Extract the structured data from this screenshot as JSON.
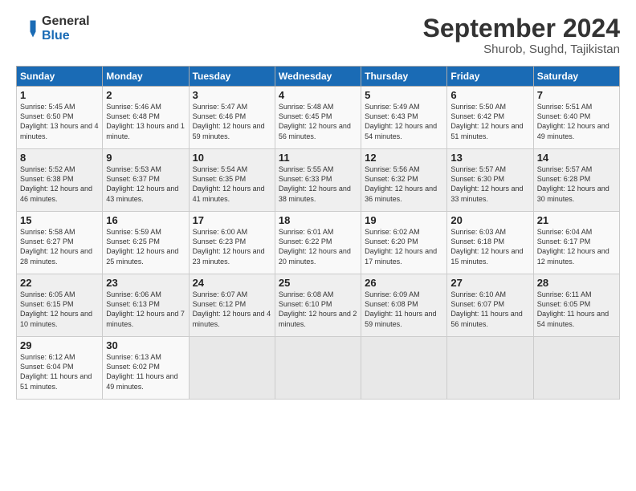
{
  "header": {
    "logo_general": "General",
    "logo_blue": "Blue",
    "month_title": "September 2024",
    "location": "Shurob, Sughd, Tajikistan"
  },
  "weekdays": [
    "Sunday",
    "Monday",
    "Tuesday",
    "Wednesday",
    "Thursday",
    "Friday",
    "Saturday"
  ],
  "weeks": [
    [
      {
        "day": "1",
        "sunrise": "5:45 AM",
        "sunset": "6:50 PM",
        "daylight": "13 hours and 4 minutes."
      },
      {
        "day": "2",
        "sunrise": "5:46 AM",
        "sunset": "6:48 PM",
        "daylight": "13 hours and 1 minute."
      },
      {
        "day": "3",
        "sunrise": "5:47 AM",
        "sunset": "6:46 PM",
        "daylight": "12 hours and 59 minutes."
      },
      {
        "day": "4",
        "sunrise": "5:48 AM",
        "sunset": "6:45 PM",
        "daylight": "12 hours and 56 minutes."
      },
      {
        "day": "5",
        "sunrise": "5:49 AM",
        "sunset": "6:43 PM",
        "daylight": "12 hours and 54 minutes."
      },
      {
        "day": "6",
        "sunrise": "5:50 AM",
        "sunset": "6:42 PM",
        "daylight": "12 hours and 51 minutes."
      },
      {
        "day": "7",
        "sunrise": "5:51 AM",
        "sunset": "6:40 PM",
        "daylight": "12 hours and 49 minutes."
      }
    ],
    [
      {
        "day": "8",
        "sunrise": "5:52 AM",
        "sunset": "6:38 PM",
        "daylight": "12 hours and 46 minutes."
      },
      {
        "day": "9",
        "sunrise": "5:53 AM",
        "sunset": "6:37 PM",
        "daylight": "12 hours and 43 minutes."
      },
      {
        "day": "10",
        "sunrise": "5:54 AM",
        "sunset": "6:35 PM",
        "daylight": "12 hours and 41 minutes."
      },
      {
        "day": "11",
        "sunrise": "5:55 AM",
        "sunset": "6:33 PM",
        "daylight": "12 hours and 38 minutes."
      },
      {
        "day": "12",
        "sunrise": "5:56 AM",
        "sunset": "6:32 PM",
        "daylight": "12 hours and 36 minutes."
      },
      {
        "day": "13",
        "sunrise": "5:57 AM",
        "sunset": "6:30 PM",
        "daylight": "12 hours and 33 minutes."
      },
      {
        "day": "14",
        "sunrise": "5:57 AM",
        "sunset": "6:28 PM",
        "daylight": "12 hours and 30 minutes."
      }
    ],
    [
      {
        "day": "15",
        "sunrise": "5:58 AM",
        "sunset": "6:27 PM",
        "daylight": "12 hours and 28 minutes."
      },
      {
        "day": "16",
        "sunrise": "5:59 AM",
        "sunset": "6:25 PM",
        "daylight": "12 hours and 25 minutes."
      },
      {
        "day": "17",
        "sunrise": "6:00 AM",
        "sunset": "6:23 PM",
        "daylight": "12 hours and 23 minutes."
      },
      {
        "day": "18",
        "sunrise": "6:01 AM",
        "sunset": "6:22 PM",
        "daylight": "12 hours and 20 minutes."
      },
      {
        "day": "19",
        "sunrise": "6:02 AM",
        "sunset": "6:20 PM",
        "daylight": "12 hours and 17 minutes."
      },
      {
        "day": "20",
        "sunrise": "6:03 AM",
        "sunset": "6:18 PM",
        "daylight": "12 hours and 15 minutes."
      },
      {
        "day": "21",
        "sunrise": "6:04 AM",
        "sunset": "6:17 PM",
        "daylight": "12 hours and 12 minutes."
      }
    ],
    [
      {
        "day": "22",
        "sunrise": "6:05 AM",
        "sunset": "6:15 PM",
        "daylight": "12 hours and 10 minutes."
      },
      {
        "day": "23",
        "sunrise": "6:06 AM",
        "sunset": "6:13 PM",
        "daylight": "12 hours and 7 minutes."
      },
      {
        "day": "24",
        "sunrise": "6:07 AM",
        "sunset": "6:12 PM",
        "daylight": "12 hours and 4 minutes."
      },
      {
        "day": "25",
        "sunrise": "6:08 AM",
        "sunset": "6:10 PM",
        "daylight": "12 hours and 2 minutes."
      },
      {
        "day": "26",
        "sunrise": "6:09 AM",
        "sunset": "6:08 PM",
        "daylight": "11 hours and 59 minutes."
      },
      {
        "day": "27",
        "sunrise": "6:10 AM",
        "sunset": "6:07 PM",
        "daylight": "11 hours and 56 minutes."
      },
      {
        "day": "28",
        "sunrise": "6:11 AM",
        "sunset": "6:05 PM",
        "daylight": "11 hours and 54 minutes."
      }
    ],
    [
      {
        "day": "29",
        "sunrise": "6:12 AM",
        "sunset": "6:04 PM",
        "daylight": "11 hours and 51 minutes."
      },
      {
        "day": "30",
        "sunrise": "6:13 AM",
        "sunset": "6:02 PM",
        "daylight": "11 hours and 49 minutes."
      },
      null,
      null,
      null,
      null,
      null
    ]
  ]
}
